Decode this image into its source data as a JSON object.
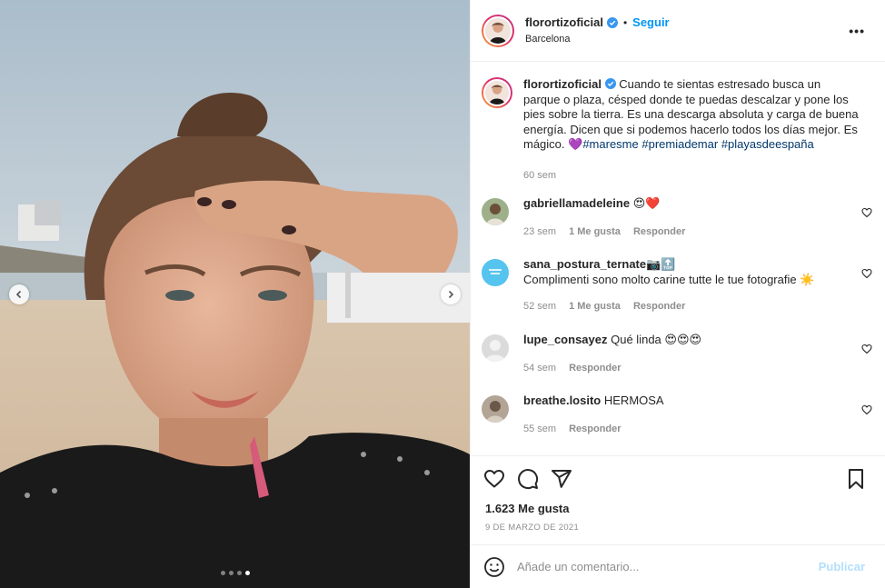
{
  "post": {
    "author": "florortizoficial",
    "location": "Barcelona",
    "follow_label": "Seguir",
    "bullet": "•",
    "more_label": "•••",
    "verified_icon": "verified-badge-icon"
  },
  "caption": {
    "username": "florortizoficial",
    "text": "Cuando te sientas estresado busca un parque o plaza, césped donde te puedas descalzar y pone los pies sobre la tierra. Es una descarga absoluta y carga de buena energía. Dicen que si podemos hacerlo todos los días mejor. Es mágico. 💜",
    "hashtags": [
      "#maresme",
      "#premiademar",
      "#playasdeespaña"
    ],
    "time": "60 sem"
  },
  "comments": [
    {
      "username": "gabriellamadeleine",
      "text": "😍❤️",
      "time": "23 sem",
      "likes": "1 Me gusta",
      "reply": "Responder"
    },
    {
      "username": "sana_postura_ternate",
      "badge": "📷🔝",
      "text": "Complimenti sono molto carine tutte le tue fotografie ☀️",
      "time": "52 sem",
      "likes": "1 Me gusta",
      "reply": "Responder"
    },
    {
      "username": "lupe_consayez",
      "text": "Qué linda 😍😍😍",
      "time": "54 sem",
      "reply": "Responder"
    },
    {
      "username": "breathe.losito",
      "text": "HERMOSA",
      "time": "55 sem",
      "reply": "Responder"
    }
  ],
  "footer": {
    "likes": "1.623 Me gusta",
    "date": "9 DE MARZO DE 2021",
    "comment_placeholder": "Añade un comentario...",
    "publish_label": "Publicar"
  },
  "carousel": {
    "slide_count": 4,
    "active_index": 3
  },
  "colors": {
    "accent": "#0095f6",
    "publish_disabled": "#b2dffc",
    "muted": "#8e8e8e",
    "hashtag": "#00376b"
  }
}
